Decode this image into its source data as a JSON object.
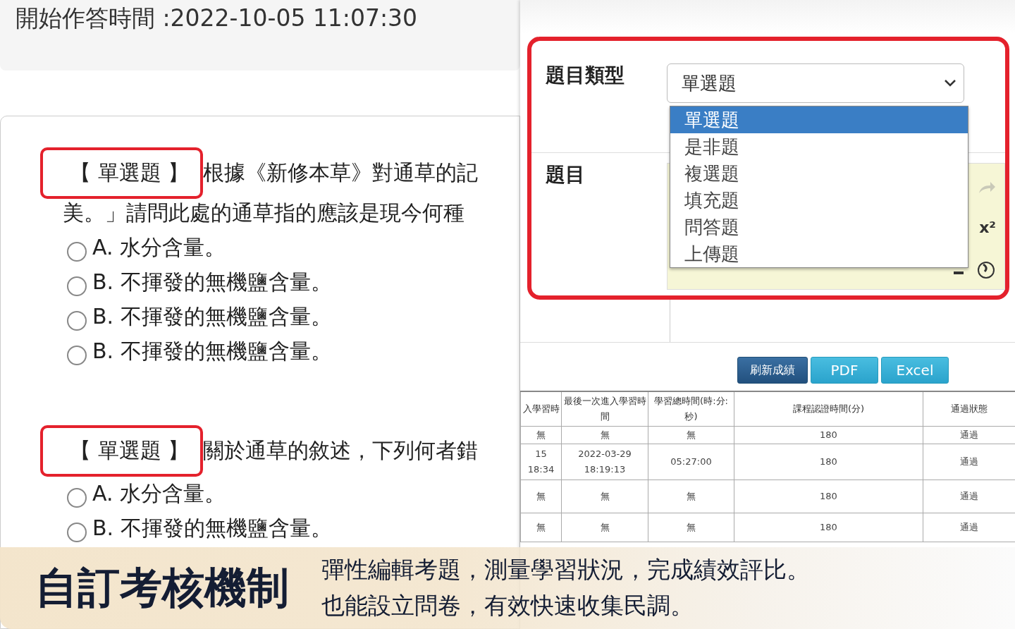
{
  "exam_header": {
    "start_time": "開始作答時間 :2022-10-05 11:07:30"
  },
  "questions": [
    {
      "tag": "【 單選題 】",
      "text": "根據《新修本草》對通草的記",
      "text_line_2": "美。」請問此處的通草指的應該是現今何種",
      "options": [
        {
          "label": "A. 水分含量。",
          "checked": false
        },
        {
          "label": "B. 不揮發的無機鹽含量。",
          "checked": false
        },
        {
          "label": "B. 不揮發的無機鹽含量。",
          "checked": false
        },
        {
          "label": "B. 不揮發的無機鹽含量。",
          "checked": false
        }
      ]
    },
    {
      "tag": "【 單選題 】",
      "text": "關於通草的敘述，下列何者錯",
      "options": [
        {
          "label": "A. 水分含量。",
          "checked": false
        },
        {
          "label": "B. 不揮發的無機鹽含量。",
          "checked": false
        }
      ]
    }
  ],
  "editor": {
    "type_label": "題目類型",
    "type_value": "單選題",
    "type_options": [
      {
        "label": "單選題",
        "selected": true
      },
      {
        "label": "是非題",
        "selected": false
      },
      {
        "label": "複選題",
        "selected": false
      },
      {
        "label": "填充題",
        "selected": false
      },
      {
        "label": "問答題",
        "selected": false
      },
      {
        "label": "上傳題",
        "selected": false
      }
    ],
    "question_label": "題目",
    "superscript_tool": "x²"
  },
  "report": {
    "buttons": [
      {
        "label": "刷新成績",
        "kind": "primary"
      },
      {
        "label": "PDF",
        "kind": "info"
      },
      {
        "label": "Excel",
        "kind": "info"
      }
    ],
    "columns": [
      "入學習時",
      "最後一次進入學習時間",
      "學習總時間(時:分:秒)",
      "課程認證時間(分)",
      "通過狀態"
    ],
    "rows": [
      [
        "無",
        "無",
        "無",
        "180",
        "通過"
      ],
      [
        "15 18:34",
        "2022-03-29 18:19:13",
        "05:27:00",
        "180",
        "通過"
      ],
      [
        "無",
        "無",
        "無",
        "180",
        "通過"
      ],
      [
        "無",
        "無",
        "無",
        "180",
        "通過"
      ]
    ]
  },
  "banner": {
    "title": "自訂考核機制",
    "lines": [
      "彈性編輯考題，測量學習狀況，完成績效評比。",
      "也能設立問卷，有效快速收集民調。"
    ]
  }
}
